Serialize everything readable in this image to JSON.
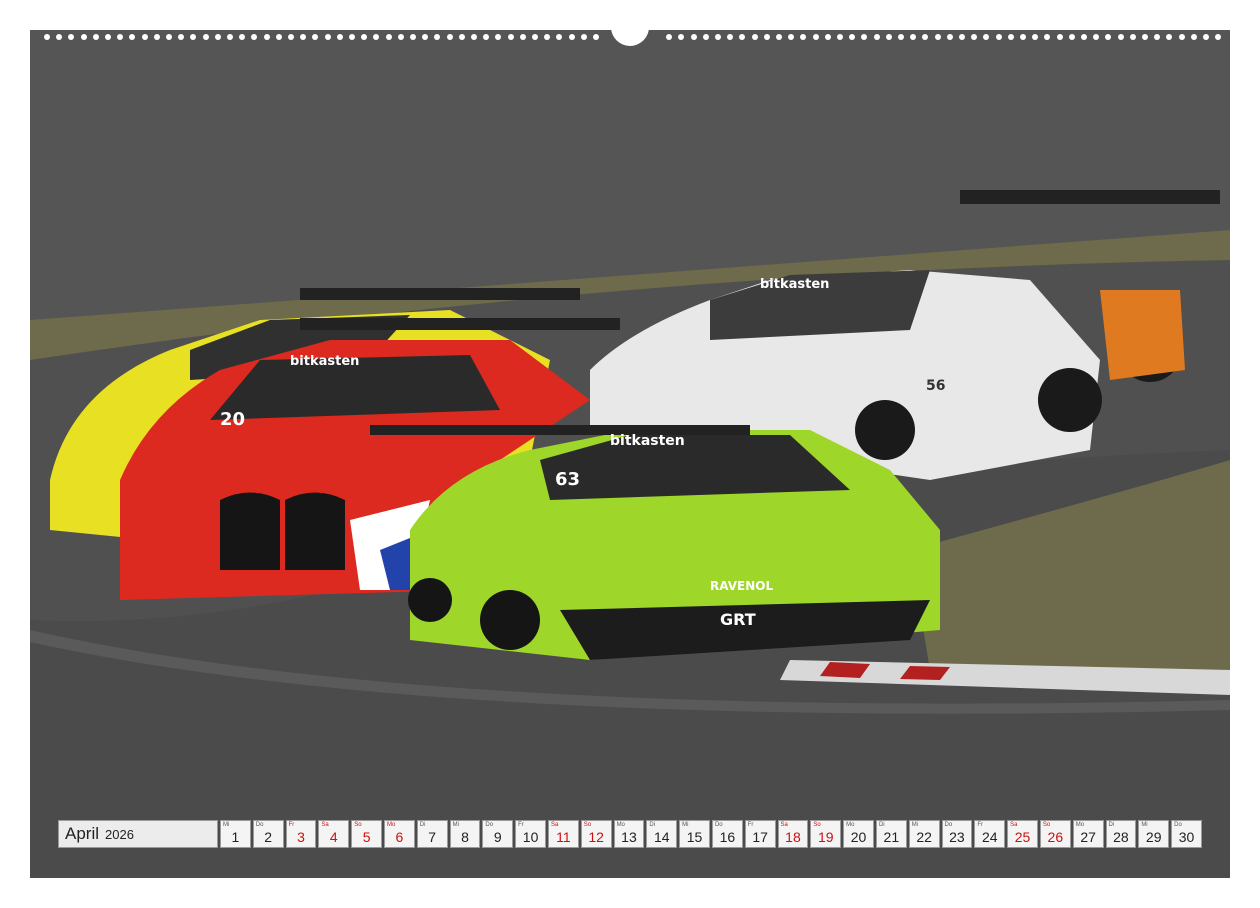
{
  "calendar": {
    "month": "April",
    "year": "2026",
    "days": [
      {
        "wd": "Mi",
        "d": "1",
        "red": false
      },
      {
        "wd": "Do",
        "d": "2",
        "red": false
      },
      {
        "wd": "Fr",
        "d": "3",
        "red": true
      },
      {
        "wd": "Sa",
        "d": "4",
        "red": true
      },
      {
        "wd": "So",
        "d": "5",
        "red": true
      },
      {
        "wd": "Mo",
        "d": "6",
        "red": true
      },
      {
        "wd": "Di",
        "d": "7",
        "red": false
      },
      {
        "wd": "Mi",
        "d": "8",
        "red": false
      },
      {
        "wd": "Do",
        "d": "9",
        "red": false
      },
      {
        "wd": "Fr",
        "d": "10",
        "red": false
      },
      {
        "wd": "Sa",
        "d": "11",
        "red": true
      },
      {
        "wd": "So",
        "d": "12",
        "red": true
      },
      {
        "wd": "Mo",
        "d": "13",
        "red": false
      },
      {
        "wd": "Di",
        "d": "14",
        "red": false
      },
      {
        "wd": "Mi",
        "d": "15",
        "red": false
      },
      {
        "wd": "Do",
        "d": "16",
        "red": false
      },
      {
        "wd": "Fr",
        "d": "17",
        "red": false
      },
      {
        "wd": "Sa",
        "d": "18",
        "red": true
      },
      {
        "wd": "So",
        "d": "19",
        "red": true
      },
      {
        "wd": "Mo",
        "d": "20",
        "red": false
      },
      {
        "wd": "Di",
        "d": "21",
        "red": false
      },
      {
        "wd": "Mi",
        "d": "22",
        "red": false
      },
      {
        "wd": "Do",
        "d": "23",
        "red": false
      },
      {
        "wd": "Fr",
        "d": "24",
        "red": false
      },
      {
        "wd": "Sa",
        "d": "25",
        "red": true
      },
      {
        "wd": "So",
        "d": "26",
        "red": true
      },
      {
        "wd": "Mo",
        "d": "27",
        "red": false
      },
      {
        "wd": "Di",
        "d": "28",
        "red": false
      },
      {
        "wd": "Mi",
        "d": "29",
        "red": false
      },
      {
        "wd": "Do",
        "d": "30",
        "red": false
      }
    ]
  },
  "photo": {
    "cars": [
      {
        "number": "63",
        "livery": "bitkasten",
        "partner": "RAVENOL",
        "team": "GRT"
      },
      {
        "number": "20",
        "livery": "bitkasten"
      },
      {
        "number": "56",
        "livery": "bitkasten"
      }
    ],
    "colors": {
      "track": "#4b4b4b",
      "grass": "#6e6a4c",
      "green_car": "#9fd62a",
      "red_car": "#dd2a20",
      "white_car": "#e8e8e8",
      "yellow_car": "#e8e023"
    }
  }
}
